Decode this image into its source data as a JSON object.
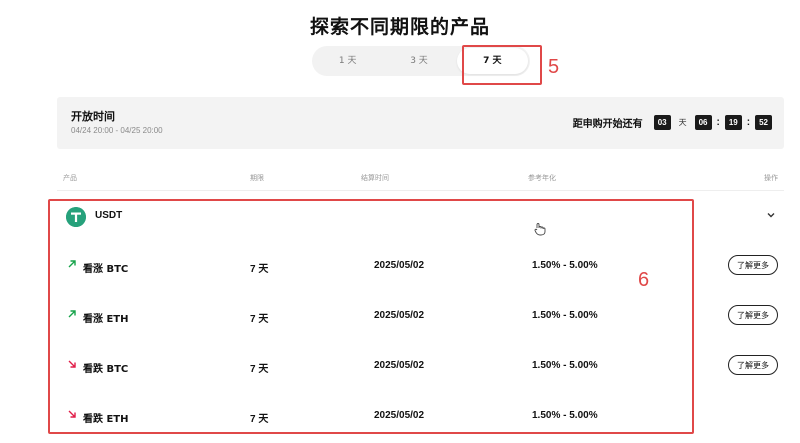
{
  "title": "探索不同期限的产品",
  "tabs": [
    {
      "label": "1 天",
      "active": false
    },
    {
      "label": "3 天",
      "active": false
    },
    {
      "label": "7 天",
      "active": true
    }
  ],
  "annotations": {
    "tab_marker": "5",
    "table_marker": "6"
  },
  "open_time": {
    "label": "开放时间",
    "range": "04/24 20:00 - 04/25 20:00",
    "countdown_label": "距申购开始还有",
    "days": "03",
    "days_unit": "天",
    "hours": "06",
    "minutes": "19",
    "seconds": "52"
  },
  "columns": {
    "product": "产品",
    "term": "期限",
    "settle": "结算时间",
    "apr": "参考年化",
    "action": "操作"
  },
  "group": {
    "asset": "USDT",
    "icon": "tether-icon"
  },
  "rows": [
    {
      "name": "看涨 BTC",
      "direction": "up",
      "term": "7 天",
      "settle": "2025/05/02",
      "apr": "1.50% - 5.00%",
      "button": "了解更多"
    },
    {
      "name": "看涨 ETH",
      "direction": "up",
      "term": "7 天",
      "settle": "2025/05/02",
      "apr": "1.50% - 5.00%",
      "button": "了解更多"
    },
    {
      "name": "看跌 BTC",
      "direction": "down",
      "term": "7 天",
      "settle": "2025/05/02",
      "apr": "1.50% - 5.00%",
      "button": "了解更多"
    },
    {
      "name": "看跌 ETH",
      "direction": "down",
      "term": "7 天",
      "settle": "2025/05/02",
      "apr": "1.50% - 5.00%"
    }
  ],
  "colors": {
    "up": "#16a34a",
    "down": "#e11d48",
    "annotation": "#e04848",
    "tether": "#26a17b"
  }
}
